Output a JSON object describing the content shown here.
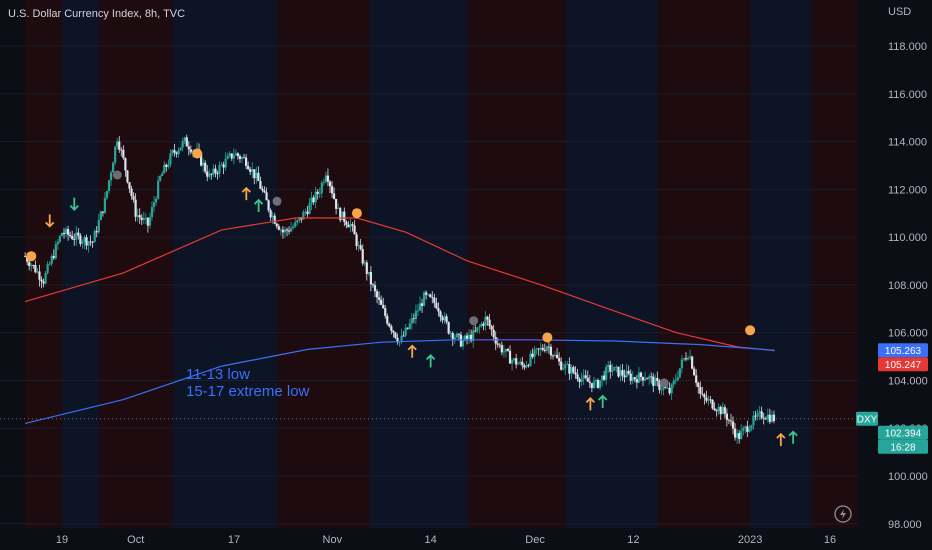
{
  "header": {
    "title": "U.S. Dollar Currency Index, 8h, TVC",
    "currency": "USD"
  },
  "colors": {
    "background": "#0b0e14",
    "band_dark_blue": "#0d1426",
    "band_dark_red": "#1e0b0f",
    "candle_up": "#26a69a",
    "candle_down": "#e0e3eb",
    "ma_red": "#e53935",
    "ma_blue": "#3a6ff7",
    "marker_orange": "#f7a54b",
    "marker_gray": "#6b6e7a",
    "arrow_orange": "#f7a54b",
    "arrow_green": "#3fc48a",
    "annotation": "#3a6ff7"
  },
  "chart_data": {
    "type": "candlestick",
    "x_axis": {
      "tick_labels": [
        "19",
        "Oct",
        "17",
        "Nov",
        "14",
        "Dec",
        "12",
        "2023",
        "16"
      ],
      "tick_positions_day_index": [
        0,
        12,
        28,
        44,
        60,
        77,
        93,
        112,
        125
      ]
    },
    "y_axis": {
      "ylim": [
        97.7,
        119.3
      ],
      "tick_values": [
        98,
        100,
        102,
        104,
        106,
        108,
        110,
        112,
        114,
        116,
        118
      ],
      "tick_labels": [
        "98.000",
        "100.000",
        "102.000",
        "104.000",
        "106.000",
        "108.000",
        "110.000",
        "112.000",
        "114.000",
        "116.000",
        "118.000"
      ]
    },
    "anchors": [
      [
        -6,
        109.2
      ],
      [
        -3,
        108.2
      ],
      [
        0,
        110.2
      ],
      [
        2,
        110.0
      ],
      [
        5,
        109.8
      ],
      [
        7,
        111.5
      ],
      [
        9,
        114.2
      ],
      [
        10,
        113.2
      ],
      [
        12,
        111.0
      ],
      [
        14,
        110.5
      ],
      [
        16,
        112.5
      ],
      [
        18,
        113.5
      ],
      [
        20,
        114.0
      ],
      [
        22,
        113.5
      ],
      [
        24,
        112.5
      ],
      [
        26,
        113.0
      ],
      [
        28,
        113.5
      ],
      [
        30,
        113.2
      ],
      [
        32,
        112.3
      ],
      [
        34,
        111.0
      ],
      [
        36,
        110.2
      ],
      [
        38,
        110.5
      ],
      [
        40,
        111.2
      ],
      [
        42,
        112.0
      ],
      [
        43,
        112.8
      ],
      [
        45,
        111.0
      ],
      [
        47,
        110.5
      ],
      [
        49,
        109.0
      ],
      [
        51,
        107.6
      ],
      [
        53,
        106.5
      ],
      [
        55,
        105.6
      ],
      [
        57,
        106.5
      ],
      [
        59,
        107.5
      ],
      [
        61,
        107.2
      ],
      [
        63,
        106.1
      ],
      [
        65,
        105.6
      ],
      [
        67,
        105.9
      ],
      [
        69,
        106.6
      ],
      [
        71,
        105.5
      ],
      [
        73,
        104.9
      ],
      [
        75,
        104.6
      ],
      [
        77,
        105.1
      ],
      [
        79,
        105.5
      ],
      [
        81,
        104.7
      ],
      [
        83,
        104.4
      ],
      [
        85,
        104.0
      ],
      [
        87,
        103.8
      ],
      [
        89,
        104.5
      ],
      [
        91,
        104.3
      ],
      [
        93,
        104.1
      ],
      [
        95,
        104.2
      ],
      [
        97,
        103.8
      ],
      [
        99,
        103.5
      ],
      [
        101,
        104.8
      ],
      [
        102,
        105.2
      ],
      [
        104,
        103.3
      ],
      [
        106,
        103.0
      ],
      [
        108,
        102.6
      ],
      [
        110,
        101.6
      ],
      [
        112,
        102.2
      ],
      [
        114,
        102.6
      ],
      [
        116,
        102.4
      ]
    ],
    "series": [
      {
        "name": "",
        "type": "line",
        "points": [
          [
            -6,
            107.3
          ],
          [
            10,
            108.5
          ],
          [
            26,
            110.3
          ],
          [
            38,
            110.8
          ],
          [
            48,
            110.8
          ],
          [
            56,
            110.2
          ],
          [
            66,
            109.0
          ],
          [
            78,
            108.0
          ],
          [
            90,
            106.9
          ],
          [
            100,
            106.0
          ],
          [
            110,
            105.4
          ],
          [
            116,
            105.25
          ]
        ]
      },
      {
        "name": "",
        "type": "line",
        "points": [
          [
            -6,
            102.2
          ],
          [
            10,
            103.2
          ],
          [
            26,
            104.6
          ],
          [
            40,
            105.3
          ],
          [
            52,
            105.6
          ],
          [
            64,
            105.7
          ],
          [
            76,
            105.7
          ],
          [
            90,
            105.65
          ],
          [
            104,
            105.5
          ],
          [
            116,
            105.26
          ]
        ]
      }
    ],
    "markers": [
      {
        "kind": "dot",
        "color": "orange",
        "x": -5,
        "y": 109.2
      },
      {
        "kind": "dot",
        "color": "gray",
        "x": 9,
        "y": 112.6
      },
      {
        "kind": "dot",
        "color": "orange",
        "x": 22,
        "y": 113.5
      },
      {
        "kind": "dot",
        "color": "gray",
        "x": 35,
        "y": 111.5
      },
      {
        "kind": "dot",
        "color": "orange",
        "x": 48,
        "y": 111.0
      },
      {
        "kind": "dot",
        "color": "gray",
        "x": 67,
        "y": 106.5
      },
      {
        "kind": "dot",
        "color": "orange",
        "x": 79,
        "y": 105.8
      },
      {
        "kind": "dot",
        "color": "gray",
        "x": 98,
        "y": 103.9
      },
      {
        "kind": "dot",
        "color": "orange",
        "x": 112,
        "y": 106.1
      },
      {
        "kind": "arrow-down",
        "color": "orange",
        "x": -2,
        "y": 110.7
      },
      {
        "kind": "arrow-down",
        "color": "green",
        "x": 2,
        "y": 111.4
      },
      {
        "kind": "arrow-up",
        "color": "orange",
        "x": 30,
        "y": 111.8
      },
      {
        "kind": "arrow-up",
        "color": "green",
        "x": 32,
        "y": 111.3
      },
      {
        "kind": "arrow-up",
        "color": "orange",
        "x": 57,
        "y": 105.2
      },
      {
        "kind": "arrow-up",
        "color": "green",
        "x": 60,
        "y": 104.8
      },
      {
        "kind": "arrow-up",
        "color": "orange",
        "x": 86,
        "y": 103.0
      },
      {
        "kind": "arrow-up",
        "color": "green",
        "x": 88,
        "y": 103.1
      },
      {
        "kind": "arrow-up",
        "color": "orange",
        "x": 117,
        "y": 101.5
      },
      {
        "kind": "arrow-up",
        "color": "green",
        "x": 119,
        "y": 101.6
      }
    ],
    "bands": [
      {
        "color": "red",
        "from": -6,
        "to": 0
      },
      {
        "color": "blue",
        "from": 0,
        "to": 6
      },
      {
        "color": "red",
        "from": 6,
        "to": 18
      },
      {
        "color": "blue",
        "from": 18,
        "to": 35
      },
      {
        "color": "red",
        "from": 35,
        "to": 50
      },
      {
        "color": "blue",
        "from": 50,
        "to": 66
      },
      {
        "color": "red",
        "from": 66,
        "to": 82
      },
      {
        "color": "blue",
        "from": 82,
        "to": 97
      },
      {
        "color": "red",
        "from": 97,
        "to": 112
      },
      {
        "color": "blue",
        "from": 112,
        "to": 122
      },
      {
        "color": "red",
        "from": 122,
        "to": 130
      }
    ],
    "last_price_line": 102.394,
    "price_badges": [
      {
        "label": "105.263",
        "value": 105.263,
        "color": "#3a6ff7"
      },
      {
        "label": "105.247",
        "value": 105.247,
        "color": "#e53935"
      },
      {
        "label": "DXY",
        "value": 102.394,
        "color": "#26a69a"
      },
      {
        "label": "102.394",
        "value": 102.394,
        "color": "#26a69a"
      },
      {
        "label": "16:28",
        "value": 101.85,
        "color": "#26a69a"
      }
    ],
    "annotations": [
      "11-13  low",
      "15-17 extreme low"
    ]
  }
}
